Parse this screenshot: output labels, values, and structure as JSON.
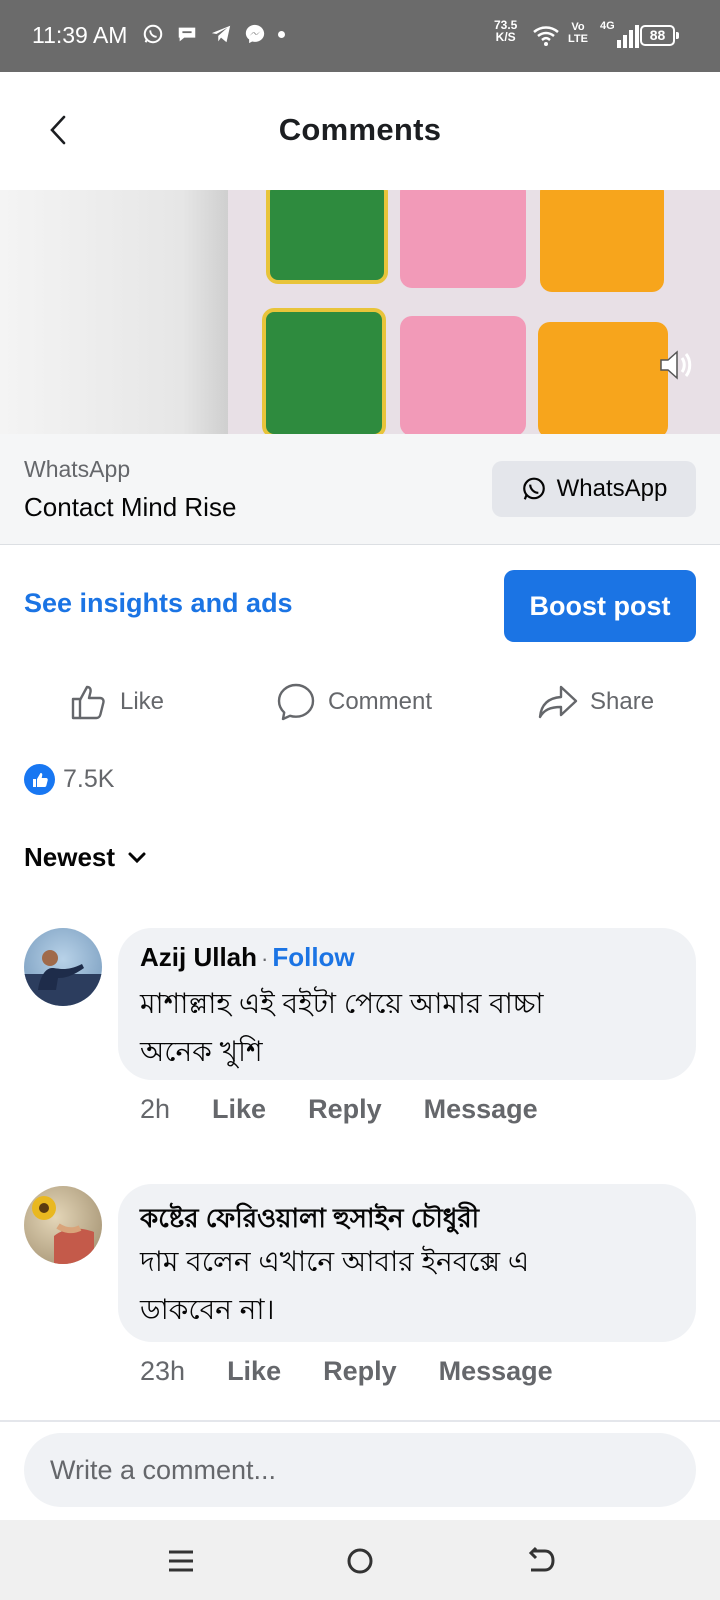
{
  "status_bar": {
    "time": "11:39 AM",
    "net_speed_value": "73.5",
    "net_speed_unit": "K/S",
    "volte_top": "Vo",
    "volte_bottom": "LTE",
    "network": "4G",
    "battery": "88",
    "notification_icons": [
      "whatsapp-icon",
      "chat-icon",
      "telegram-icon",
      "messenger-icon"
    ]
  },
  "header": {
    "title": "Comments"
  },
  "post_cta": {
    "label": "WhatsApp",
    "name": "Contact Mind Rise",
    "button_label": "WhatsApp"
  },
  "insights": {
    "link_label": "See insights and ads",
    "boost_label": "Boost post"
  },
  "actions": {
    "like": "Like",
    "comment": "Comment",
    "share": "Share"
  },
  "reactions": {
    "count": "7.5K"
  },
  "sort": {
    "label": "Newest"
  },
  "comments": [
    {
      "author": "Azij Ullah",
      "follow_label": "Follow",
      "text_line1": "মাশাল্লাহ এই বইটা পেয়ে আমার বাচ্চা",
      "text_line2": "অনেক খুশি",
      "time": "2h",
      "like": "Like",
      "reply": "Reply",
      "message": "Message"
    },
    {
      "author": "কষ্টের ফেরিওয়ালা হুসাইন চৌধুরী",
      "text_line1": "দাম বলেন এখানে আবার ইনবক্সে এ",
      "text_line2": "ডাকবেন না।",
      "time": "23h",
      "like": "Like",
      "reply": "Reply",
      "message": "Message"
    }
  ],
  "composer": {
    "placeholder": "Write a comment..."
  },
  "colors": {
    "accent": "#1b74e4",
    "status_bar": "#6b6b6b",
    "bubble": "#f0f2f5",
    "secondary_text": "#65676b"
  }
}
